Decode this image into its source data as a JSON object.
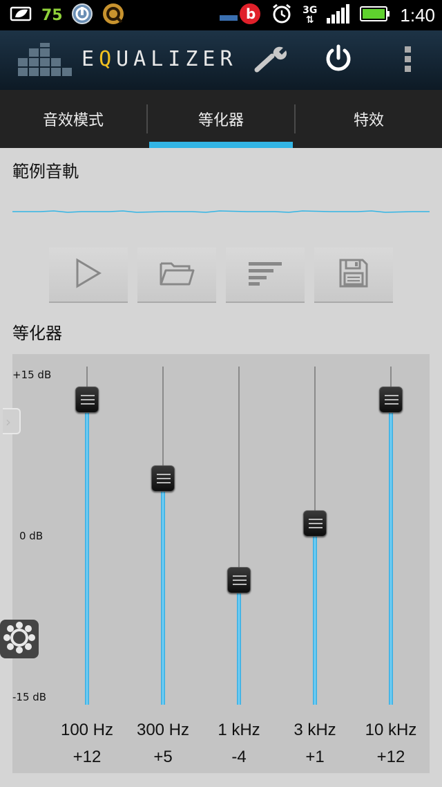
{
  "status": {
    "battery_saver_number": "75",
    "network": "3G",
    "time": "1:40"
  },
  "app": {
    "title_first": "E",
    "title_q": "Q",
    "title_rest": "UALIZER"
  },
  "tabs": [
    {
      "label": "音效模式",
      "active": false
    },
    {
      "label": "等化器",
      "active": true
    },
    {
      "label": "特效",
      "active": false
    }
  ],
  "sample_track": {
    "heading": "範例音軌"
  },
  "toolbar": {
    "buttons": [
      "play-icon",
      "folder-open-icon",
      "list-icon",
      "save-icon"
    ]
  },
  "equalizer": {
    "heading": "等化器",
    "db_max_label": "+15 dB",
    "db_mid_label": "0 dB",
    "db_min_label": "-15 dB",
    "range_db": [
      -15,
      15
    ],
    "accent_color": "#33b5e5",
    "bands": [
      {
        "freq": "100 Hz",
        "value_label": "+12",
        "value": 12
      },
      {
        "freq": "300 Hz",
        "value_label": "+5",
        "value": 5
      },
      {
        "freq": "1 kHz",
        "value_label": "-4",
        "value": -4
      },
      {
        "freq": "3 kHz",
        "value_label": "+1",
        "value": 1
      },
      {
        "freq": "10 kHz",
        "value_label": "+12",
        "value": 12
      }
    ]
  }
}
